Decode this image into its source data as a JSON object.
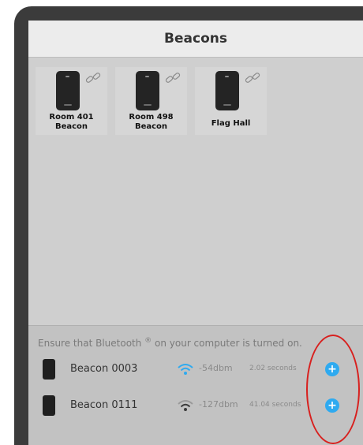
{
  "window": {
    "title": "Beacons"
  },
  "tiles": [
    {
      "label": "Room 401\nBeacon",
      "line1": "Room 401",
      "line2": "Beacon",
      "icon": "beacon-device-icon",
      "status_icon": "broken-link-icon"
    },
    {
      "label": "Room 498\nBeacon",
      "line1": "Room 498",
      "line2": "Beacon",
      "icon": "beacon-device-icon",
      "status_icon": "broken-link-icon"
    },
    {
      "label": "Flag Hall",
      "line1": "Flag Hall",
      "icon": "beacon-device-icon",
      "status_icon": "broken-link-icon"
    }
  ],
  "discovery": {
    "notice_before": "Ensure that Bluetooth",
    "notice_mark": "®",
    "notice_after": " on your computer is turned on.",
    "devices": [
      {
        "name": "Beacon 0003",
        "signal": "-54dbm",
        "last_seen": "2.02 seconds",
        "add_icon": "+"
      },
      {
        "name": "Beacon 0111",
        "signal": "-127dbm",
        "last_seen": "41.04 seconds",
        "add_icon": "+"
      }
    ]
  },
  "colors": {
    "accent": "#2eaaf0",
    "annotation": "#d8201e",
    "panel": "#cfcfcf",
    "title_bar": "#ececec"
  }
}
